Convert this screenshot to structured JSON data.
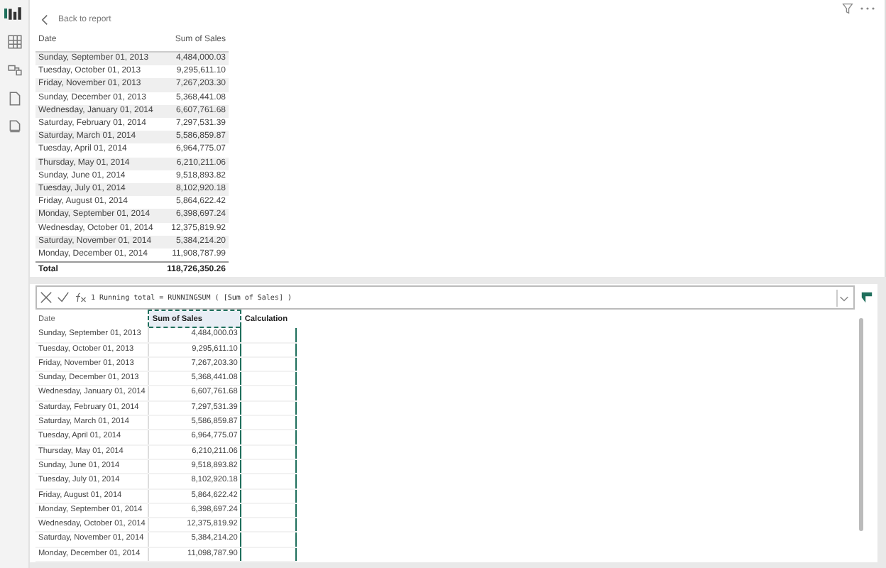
{
  "back_link": "Back to report",
  "report_table": {
    "columns": [
      "Date",
      "Sum of Sales"
    ],
    "rows": [
      [
        "Sunday, September 01, 2013",
        "4,484,000.03"
      ],
      [
        "Tuesday, October 01, 2013",
        "9,295,611.10"
      ],
      [
        "Friday, November 01, 2013",
        "7,267,203.30"
      ],
      [
        "Sunday, December 01, 2013",
        "5,368,441.08"
      ],
      [
        "Wednesday, January 01, 2014",
        "6,607,761.68"
      ],
      [
        "Saturday, February 01, 2014",
        "7,297,531.39"
      ],
      [
        "Saturday, March 01, 2014",
        "5,586,859.87"
      ],
      [
        "Tuesday, April 01, 2014",
        "6,964,775.07"
      ],
      [
        "Thursday, May 01, 2014",
        "6,210,211.06"
      ],
      [
        "Sunday, June 01, 2014",
        "9,518,893.82"
      ],
      [
        "Tuesday, July 01, 2014",
        "8,102,920.18"
      ],
      [
        "Friday, August 01, 2014",
        "5,864,622.42"
      ],
      [
        "Monday, September 01, 2014",
        "6,398,697.24"
      ],
      [
        "Wednesday, October 01, 2014",
        "12,375,819.92"
      ],
      [
        "Saturday, November 01, 2014",
        "5,384,214.20"
      ],
      [
        "Monday, December 01, 2014",
        "11,908,787.99"
      ]
    ],
    "total": [
      "Total",
      "118,726,350.26"
    ]
  },
  "formula_bar": {
    "line_number": "1",
    "formula": "Running total = RUNNINGSUM ( [Sum of Sales] )"
  },
  "data_grid": {
    "columns": [
      {
        "label": "Date",
        "selected": false
      },
      {
        "label": "Sum of Sales",
        "selected": true
      },
      {
        "label": "Calculation",
        "selected": false
      }
    ],
    "rows": [
      [
        "Sunday, September 01, 2013",
        "4,484,000.03"
      ],
      [
        "Tuesday, October 01, 2013",
        "9,295,611.10"
      ],
      [
        "Friday, November 01, 2013",
        "7,267,203.30"
      ],
      [
        "Sunday, December 01, 2013",
        "5,368,441.08"
      ],
      [
        "Wednesday, January 01, 2014",
        "6,607,761.68"
      ],
      [
        "Saturday, February 01, 2014",
        "7,297,531.39"
      ],
      [
        "Saturday, March 01, 2014",
        "5,586,859.87"
      ],
      [
        "Tuesday, April 01, 2014",
        "6,964,775.07"
      ],
      [
        "Thursday, May 01, 2014",
        "6,210,211.06"
      ],
      [
        "Sunday, June 01, 2014",
        "9,518,893.82"
      ],
      [
        "Tuesday, July 01, 2014",
        "8,102,920.18"
      ],
      [
        "Friday, August 01, 2014",
        "5,864,622.42"
      ],
      [
        "Monday, September 01, 2014",
        "6,398,697.24"
      ],
      [
        "Wednesday, October 01, 2014",
        "12,375,819.92"
      ],
      [
        "Saturday, November 01, 2014",
        "5,384,214.20"
      ],
      [
        "Monday, December 01, 2014",
        "11,098,787.90"
      ]
    ]
  }
}
